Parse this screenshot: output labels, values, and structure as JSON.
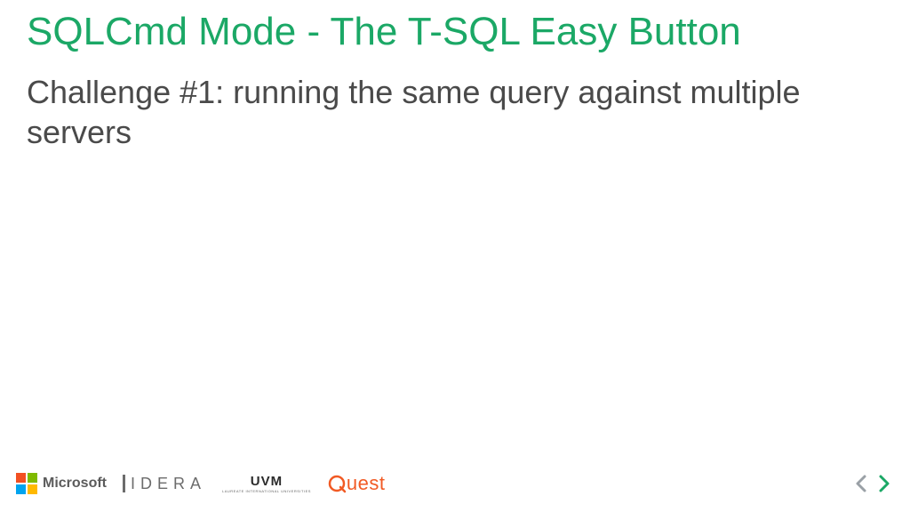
{
  "slide": {
    "title": "SQLCmd Mode - The T-SQL Easy Button",
    "subtitle": "Challenge #1: running the same query against multiple servers"
  },
  "sponsors": {
    "microsoft": "Microsoft",
    "idera": "IDERA",
    "uvm": "UVM",
    "uvm_sub": "LAUREATE INTERNATIONAL UNIVERSITIES",
    "quest": "uest"
  },
  "colors": {
    "title": "#1BA866",
    "body": "#4a4a4a",
    "quest": "#F15A24",
    "arrow_prev": "#9aa0a6",
    "arrow_next": "#1BA866"
  }
}
